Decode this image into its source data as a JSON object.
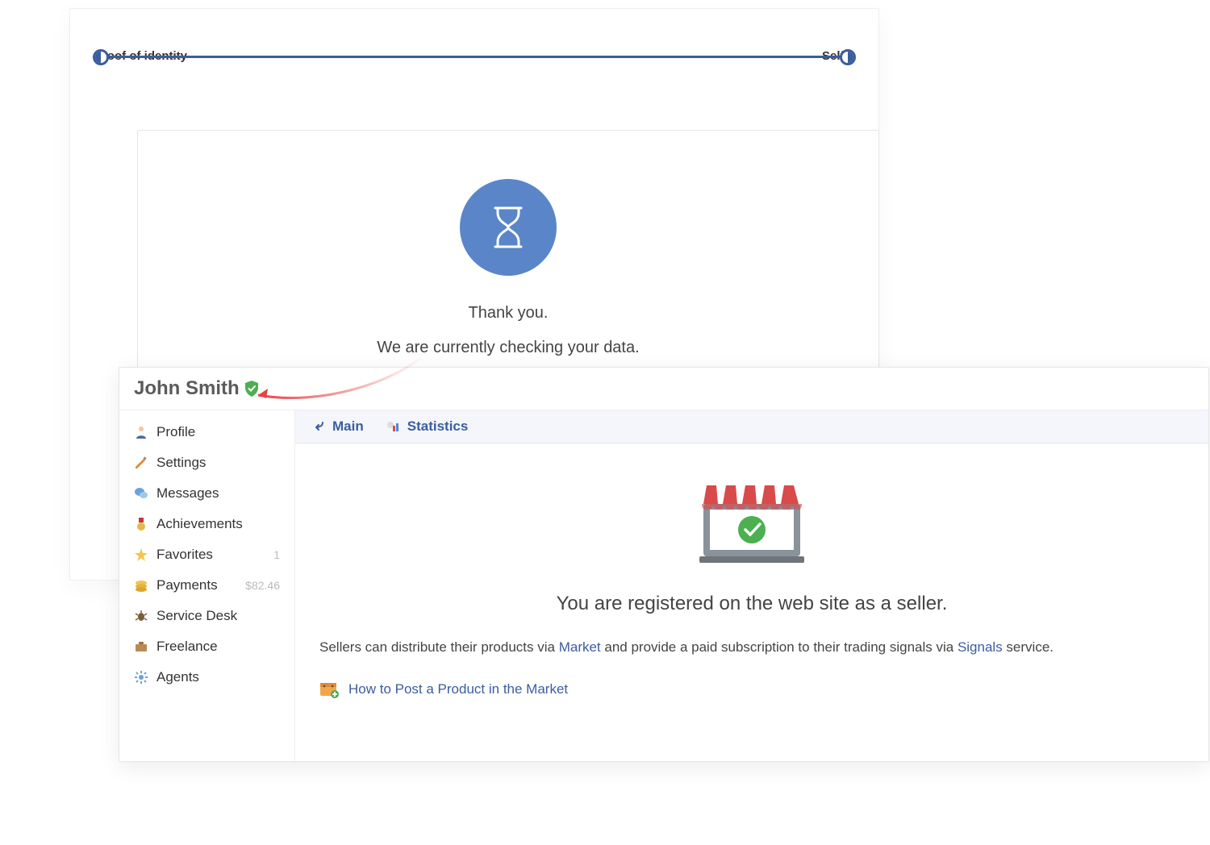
{
  "verification": {
    "step_left": "Proof of identity",
    "step_right": "Selfie",
    "pending_line1": "Thank you.",
    "pending_line2": "We are currently checking your data."
  },
  "profile": {
    "name": "John Smith"
  },
  "sidebar": {
    "items": [
      {
        "label": "Profile",
        "icon": "person"
      },
      {
        "label": "Settings",
        "icon": "pencil"
      },
      {
        "label": "Messages",
        "icon": "chat"
      },
      {
        "label": "Achievements",
        "icon": "medal"
      },
      {
        "label": "Favorites",
        "icon": "star",
        "badge": "1"
      },
      {
        "label": "Payments",
        "icon": "coins",
        "badge": "$82.46"
      },
      {
        "label": "Service Desk",
        "icon": "bug"
      },
      {
        "label": "Freelance",
        "icon": "briefcase"
      },
      {
        "label": "Agents",
        "icon": "gear"
      }
    ]
  },
  "tabs": {
    "main": "Main",
    "stats": "Statistics"
  },
  "seller": {
    "title": "You are registered on the web site as a seller.",
    "desc_before": "Sellers can distribute their products via ",
    "link_market": "Market",
    "desc_mid": " and provide a paid subscription to their trading signals via ",
    "link_signals": "Signals",
    "desc_after": " service.",
    "howto": "How to Post a Product in the Market"
  }
}
